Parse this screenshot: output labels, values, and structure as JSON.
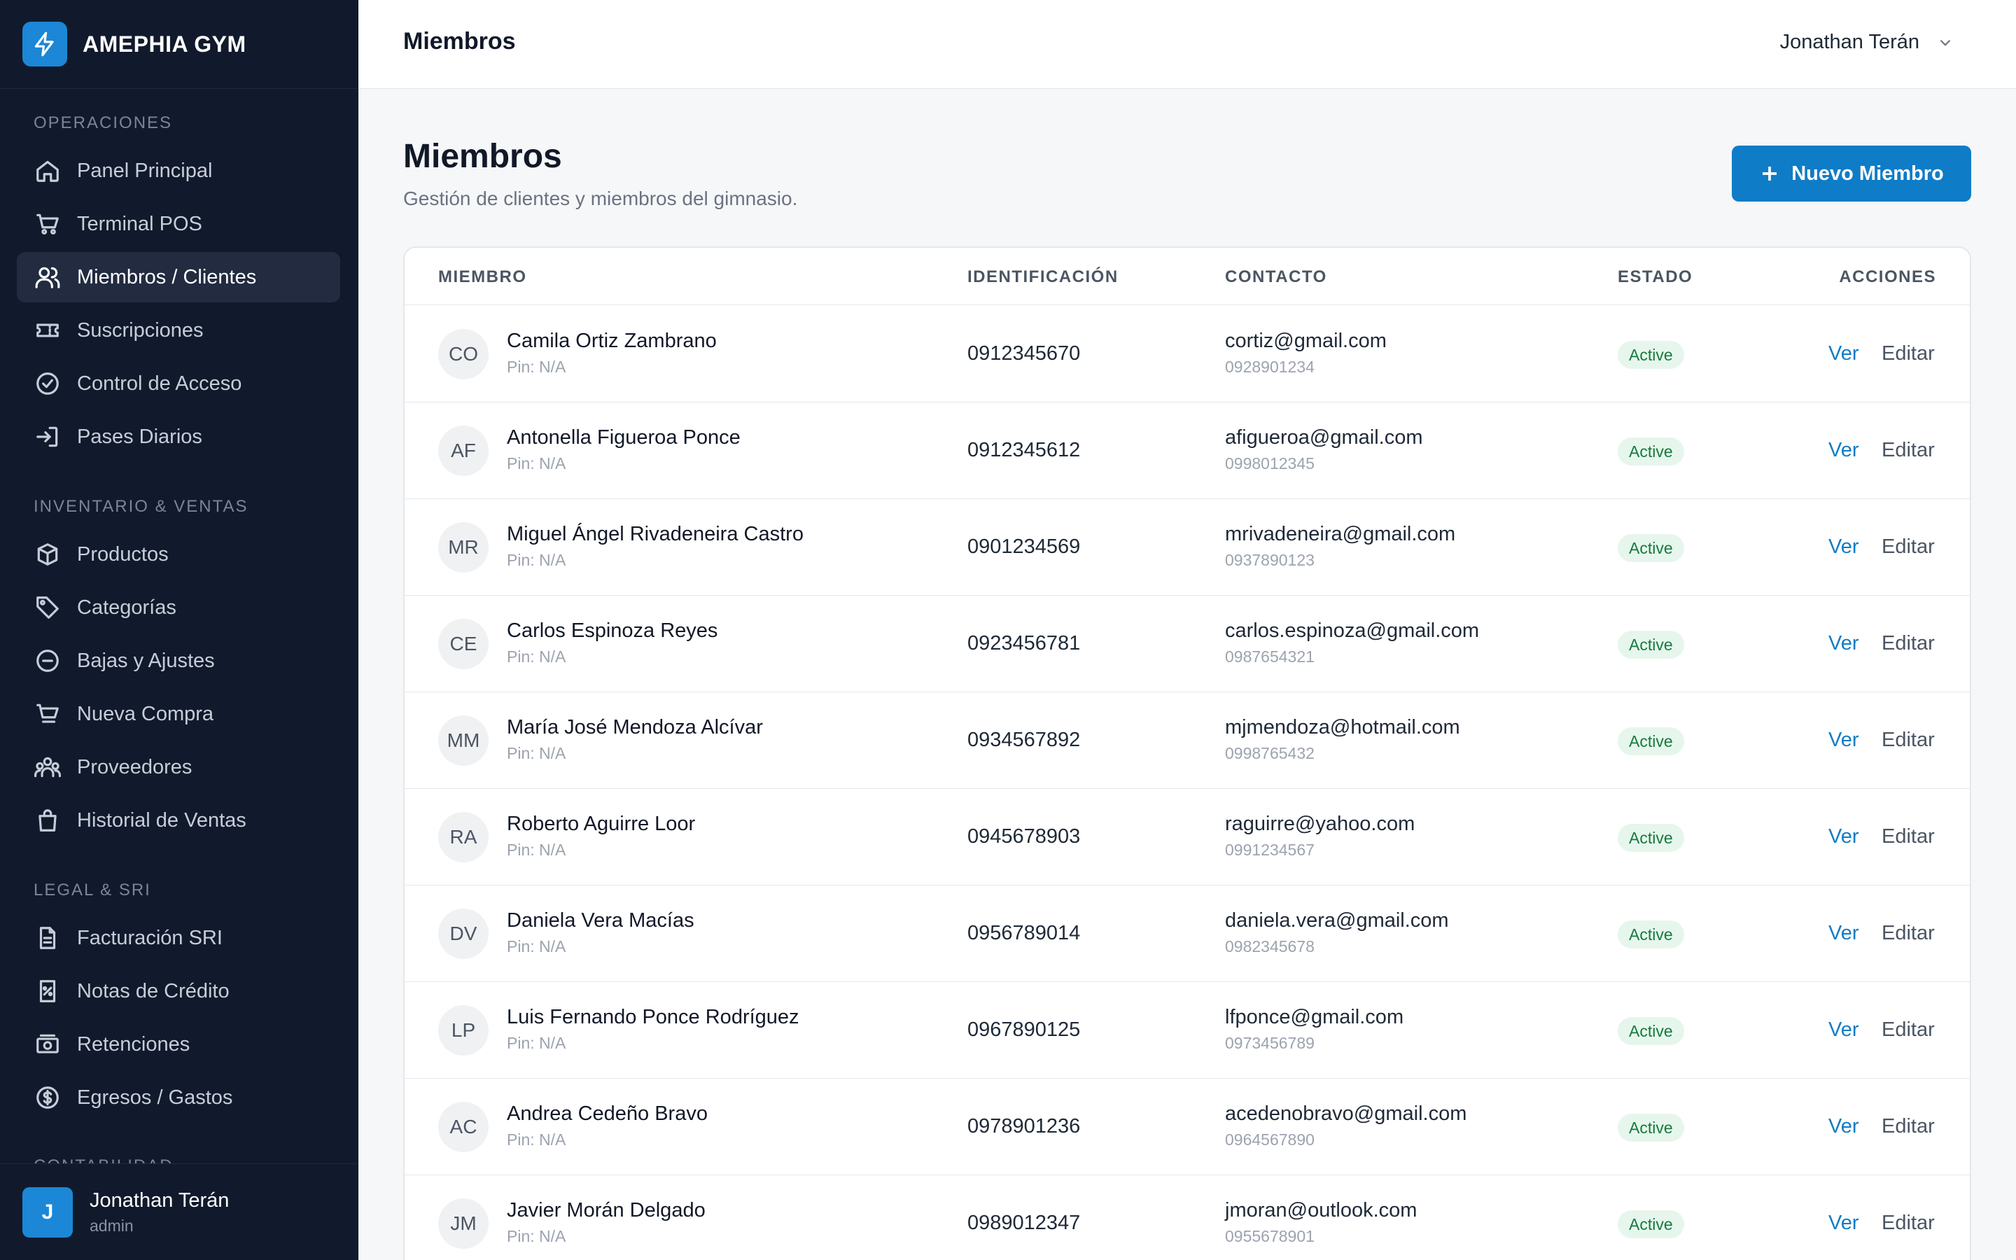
{
  "brand": {
    "name": "AMEPHIA GYM"
  },
  "sidebar": {
    "sections": [
      {
        "label": "OPERACIONES"
      },
      {
        "label": "INVENTARIO & VENTAS"
      },
      {
        "label": "LEGAL & SRI"
      },
      {
        "label": "CONTABILIDAD"
      }
    ],
    "items": [
      {
        "label": "Panel Principal",
        "icon": "home-icon"
      },
      {
        "label": "Terminal POS",
        "icon": "cart-icon"
      },
      {
        "label": "Miembros / Clientes",
        "icon": "users-icon",
        "active": true
      },
      {
        "label": "Suscripciones",
        "icon": "ticket-icon"
      },
      {
        "label": "Control de Acceso",
        "icon": "check-circle-icon"
      },
      {
        "label": "Pases Diarios",
        "icon": "login-icon"
      },
      {
        "label": "Productos",
        "icon": "box-icon"
      },
      {
        "label": "Categorías",
        "icon": "tag-icon"
      },
      {
        "label": "Bajas y Ajustes",
        "icon": "minus-circle-icon"
      },
      {
        "label": "Nueva Compra",
        "icon": "cart-plus-icon"
      },
      {
        "label": "Proveedores",
        "icon": "team-icon"
      },
      {
        "label": "Historial de Ventas",
        "icon": "bag-icon"
      },
      {
        "label": "Facturación SRI",
        "icon": "document-icon"
      },
      {
        "label": "Notas de Crédito",
        "icon": "receipt-icon"
      },
      {
        "label": "Retenciones",
        "icon": "cash-icon"
      },
      {
        "label": "Egresos / Gastos",
        "icon": "dollar-icon"
      }
    ],
    "user": {
      "initial": "J",
      "name": "Jonathan Terán",
      "role": "admin"
    }
  },
  "header": {
    "title": "Miembros",
    "user_name": "Jonathan Terán"
  },
  "main": {
    "title": "Miembros",
    "subtitle": "Gestión de clientes y miembros del gimnasio.",
    "new_button": "Nuevo Miembro",
    "columns": [
      "MIEMBRO",
      "IDENTIFICACIÓN",
      "CONTACTO",
      "ESTADO",
      "ACCIONES"
    ],
    "view_label": "Ver",
    "edit_label": "Editar",
    "members": [
      {
        "initials": "CO",
        "name": "Camila Ortiz Zambrano",
        "pin": "Pin: N/A",
        "id": "0912345670",
        "email": "cortiz@gmail.com",
        "phone": "0928901234",
        "status": "Active"
      },
      {
        "initials": "AF",
        "name": "Antonella Figueroa Ponce",
        "pin": "Pin: N/A",
        "id": "0912345612",
        "email": "afigueroa@gmail.com",
        "phone": "0998012345",
        "status": "Active"
      },
      {
        "initials": "MR",
        "name": "Miguel Ángel Rivadeneira Castro",
        "pin": "Pin: N/A",
        "id": "0901234569",
        "email": "mrivadeneira@gmail.com",
        "phone": "0937890123",
        "status": "Active"
      },
      {
        "initials": "CE",
        "name": "Carlos Espinoza Reyes",
        "pin": "Pin: N/A",
        "id": "0923456781",
        "email": "carlos.espinoza@gmail.com",
        "phone": "0987654321",
        "status": "Active"
      },
      {
        "initials": "MM",
        "name": "María José Mendoza Alcívar",
        "pin": "Pin: N/A",
        "id": "0934567892",
        "email": "mjmendoza@hotmail.com",
        "phone": "0998765432",
        "status": "Active"
      },
      {
        "initials": "RA",
        "name": "Roberto Aguirre Loor",
        "pin": "Pin: N/A",
        "id": "0945678903",
        "email": "raguirre@yahoo.com",
        "phone": "0991234567",
        "status": "Active"
      },
      {
        "initials": "DV",
        "name": "Daniela Vera Macías",
        "pin": "Pin: N/A",
        "id": "0956789014",
        "email": "daniela.vera@gmail.com",
        "phone": "0982345678",
        "status": "Active"
      },
      {
        "initials": "LP",
        "name": "Luis Fernando Ponce Rodríguez",
        "pin": "Pin: N/A",
        "id": "0967890125",
        "email": "lfponce@gmail.com",
        "phone": "0973456789",
        "status": "Active"
      },
      {
        "initials": "AC",
        "name": "Andrea Cedeño Bravo",
        "pin": "Pin: N/A",
        "id": "0978901236",
        "email": "acedenobravo@gmail.com",
        "phone": "0964567890",
        "status": "Active"
      },
      {
        "initials": "JM",
        "name": "Javier Morán Delgado",
        "pin": "Pin: N/A",
        "id": "0989012347",
        "email": "jmoran@outlook.com",
        "phone": "0955678901",
        "status": "Active"
      }
    ]
  }
}
